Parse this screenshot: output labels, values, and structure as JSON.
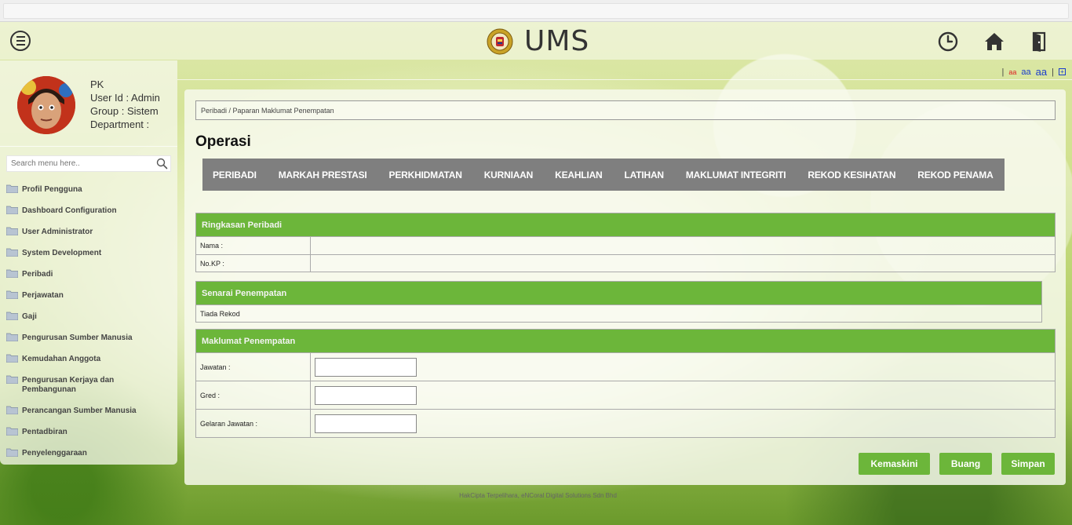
{
  "app": {
    "title": "UMS"
  },
  "font_size_bar": {
    "sep1": "|",
    "small": "aa",
    "mid": "aa",
    "big": "aa",
    "sep2": "|",
    "add": "+"
  },
  "profile": {
    "name": "PK",
    "user_id": "User Id : Admin",
    "group": "Group : Sistem",
    "department": "Department :"
  },
  "search": {
    "placeholder": "Search menu here.."
  },
  "sidebar": {
    "items": [
      {
        "label": "Profil Pengguna"
      },
      {
        "label": "Dashboard Configuration"
      },
      {
        "label": "User Administrator"
      },
      {
        "label": "System Development"
      },
      {
        "label": "Peribadi"
      },
      {
        "label": "Perjawatan"
      },
      {
        "label": "Gaji"
      },
      {
        "label": "Pengurusan Sumber Manusia"
      },
      {
        "label": "Kemudahan Anggota"
      },
      {
        "label": "Pengurusan Kerjaya dan Pembangunan"
      },
      {
        "label": "Perancangan Sumber Manusia"
      },
      {
        "label": "Pentadbiran"
      },
      {
        "label": "Penyelenggaraan"
      }
    ]
  },
  "main": {
    "breadcrumb": "Peribadi / Paparan Maklumat Penempatan",
    "title": "Operasi",
    "tabs": [
      {
        "label": "PERIBADI"
      },
      {
        "label": "MARKAH PRESTASI"
      },
      {
        "label": "PERKHIDMATAN"
      },
      {
        "label": "KURNIAAN"
      },
      {
        "label": "KEAHLIAN"
      },
      {
        "label": "LATIHAN"
      },
      {
        "label": "MAKLUMAT INTEGRITI"
      },
      {
        "label": "REKOD KESIHATAN"
      },
      {
        "label": "REKOD PENAMA"
      }
    ],
    "ringkasan": {
      "header": "Ringkasan Peribadi",
      "nama_label": "Nama :",
      "nama_value": "",
      "nokp_label": "No.KP :",
      "nokp_value": ""
    },
    "senarai": {
      "header": "Senarai Penempatan",
      "empty": "Tiada Rekod"
    },
    "maklumat": {
      "header": "Maklumat Penempatan",
      "jawatan_label": "Jawatan :",
      "jawatan_value": "",
      "gred_label": "Gred :",
      "gred_value": "",
      "gelaran_label": "Gelaran Jawatan :",
      "gelaran_value": ""
    },
    "buttons": {
      "kemaskini": "Kemaskini",
      "buang": "Buang",
      "simpan": "Simpan"
    }
  },
  "footer": {
    "text": "HakCipta Terpelihara, eNCoral Digital Solutions Sdn Bhd"
  },
  "colors": {
    "accent_green": "#6cb63a",
    "tab_bar": "#7f7f7f"
  }
}
